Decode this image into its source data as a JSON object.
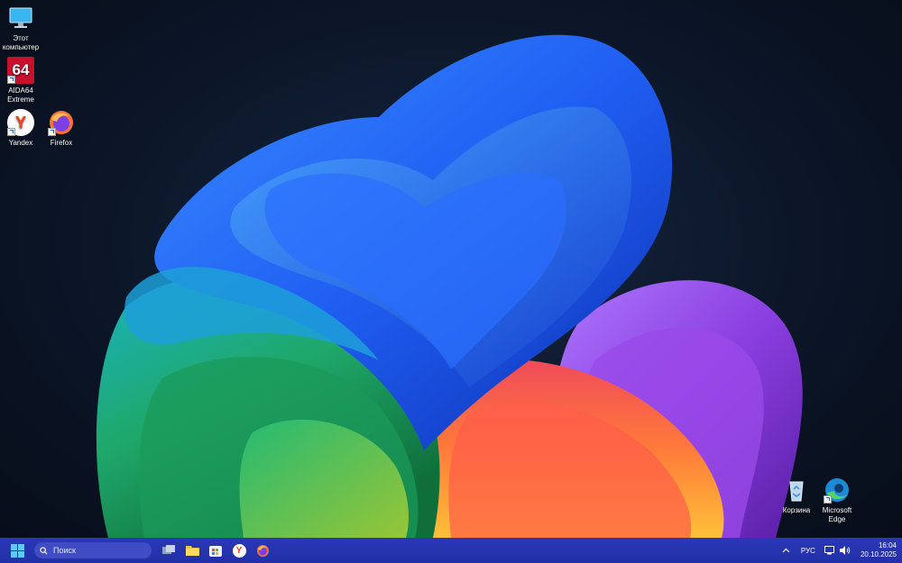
{
  "desktop": {
    "icons": [
      {
        "label": "Этот компьютер",
        "icon": "monitor-icon"
      },
      {
        "label": "AIDA64 Extreme",
        "icon": "aida64-icon",
        "badge": "64"
      },
      {
        "label": "Yandex",
        "icon": "yandex-icon",
        "badge": "Y"
      },
      {
        "label": "Firefox",
        "icon": "firefox-icon"
      },
      {
        "label": "Корзина",
        "icon": "recycle-bin-icon"
      },
      {
        "label": "Microsoft Edge",
        "icon": "edge-icon"
      }
    ]
  },
  "taskbar": {
    "search_placeholder": "Поиск",
    "pinned": [
      "start-icon",
      "task-view-icon",
      "file-explorer-icon",
      "store-icon",
      "yandex-icon",
      "firefox-icon"
    ],
    "tray": {
      "language": "РУС",
      "time": "16:04",
      "date": "20.10.2025"
    },
    "colors": {
      "background": "#2230a6",
      "search": "#3f4cc4"
    }
  }
}
